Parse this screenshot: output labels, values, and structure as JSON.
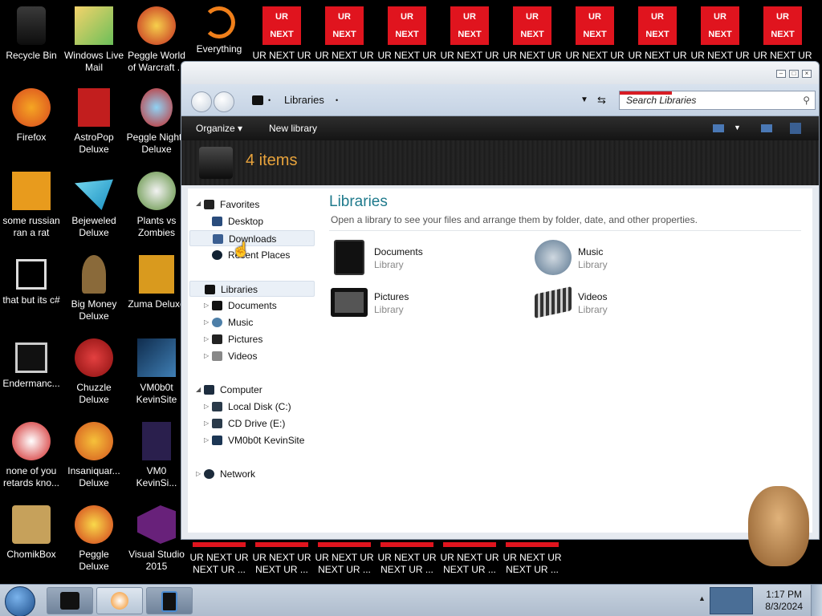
{
  "desktop": {
    "col1": [
      "Recycle Bin",
      "Firefox",
      "some russian ran a rat",
      "that but its c#",
      "Endermanc...",
      "none of you retards kno...",
      "ChomikBox"
    ],
    "col2": [
      "Windows Live Mail",
      "AstroPop Deluxe",
      "Bejeweled Deluxe",
      "Big Money Deluxe",
      "Chuzzle Deluxe",
      "Insaniquar... Deluxe",
      "Peggle Deluxe"
    ],
    "col3": [
      "Peggle World of Warcraft ...",
      "Peggle Nights Deluxe",
      "Plants vs Zombies",
      "Zuma Deluxe",
      "VM0b0t KevinSite",
      "VM0 KevinSi...",
      "Visual Studio 2015"
    ],
    "top_row_extra": [
      "Everything"
    ],
    "red_icon_text_top": "UR",
    "red_icon_text_bottom": "NEXT",
    "red_label": "UR NEXT UR",
    "red_bottom_label_1": "UR NEXT UR",
    "red_bottom_label_2": "NEXT UR ..."
  },
  "window": {
    "address_label": "Libraries",
    "search_placeholder": "Search Libraries",
    "toolbar": {
      "organize": "Organize",
      "new_library": "New library"
    },
    "item_count": "4 items",
    "nav": {
      "favorites": "Favorites",
      "desktop": "Desktop",
      "downloads": "Downloads",
      "recent_places": "Recent Places",
      "libraries": "Libraries",
      "documents": "Documents",
      "music": "Music",
      "pictures": "Pictures",
      "videos": "Videos",
      "computer": "Computer",
      "local_disk": "Local Disk (C:)",
      "cd_drive": "CD Drive (E:)",
      "vm_site": "VM0b0t KevinSite",
      "network": "Network"
    },
    "main": {
      "title": "Libraries",
      "description": "Open a library to see your files and arrange them by folder, date, and other properties.",
      "items": [
        {
          "name": "Documents",
          "type": "Library"
        },
        {
          "name": "Music",
          "type": "Library"
        },
        {
          "name": "Pictures",
          "type": "Library"
        },
        {
          "name": "Videos",
          "type": "Library"
        }
      ]
    }
  },
  "taskbar": {
    "time": "1:17 PM",
    "date": "8/3/2024"
  },
  "colors": {
    "accent_orange": "#e8a33c",
    "title_teal": "#1f7a8c",
    "red_icon": "#e0141e"
  }
}
